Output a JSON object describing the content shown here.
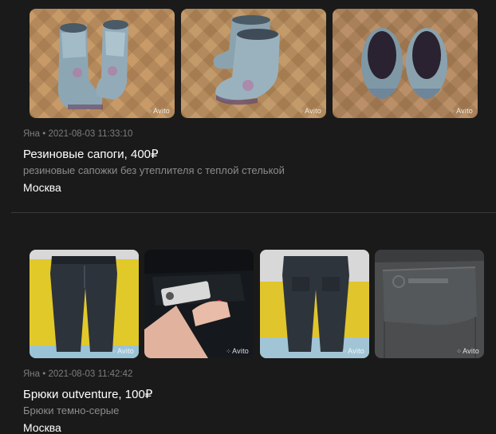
{
  "listings": [
    {
      "author": "Яна",
      "separator": "•",
      "datetime": "2021-08-03 11:33:10",
      "title": "Резиновые сапоги, 400₽",
      "description": "резиновые сапожки без утеплителя с теплой стелькой",
      "city": "Москва",
      "photos": [
        {
          "subject": "rubber-boots-pair-front",
          "watermark": "Avito"
        },
        {
          "subject": "rubber-boots-pair-side",
          "watermark": "Avito"
        },
        {
          "subject": "rubber-boots-pair-top",
          "watermark": "Avito"
        }
      ]
    },
    {
      "author": "Яна",
      "separator": "•",
      "datetime": "2021-08-03 11:42:42",
      "title": "Брюки outventure, 100₽",
      "description": "Брюки темно-серые",
      "city": "Москва",
      "photos": [
        {
          "subject": "pants-front-yellow-bg",
          "watermark": "Avito"
        },
        {
          "subject": "pants-label-closeup",
          "watermark": "Avito"
        },
        {
          "subject": "pants-back-hanging",
          "watermark": "Avito"
        },
        {
          "subject": "pants-pocket-logo",
          "watermark": "Avito"
        }
      ]
    }
  ]
}
